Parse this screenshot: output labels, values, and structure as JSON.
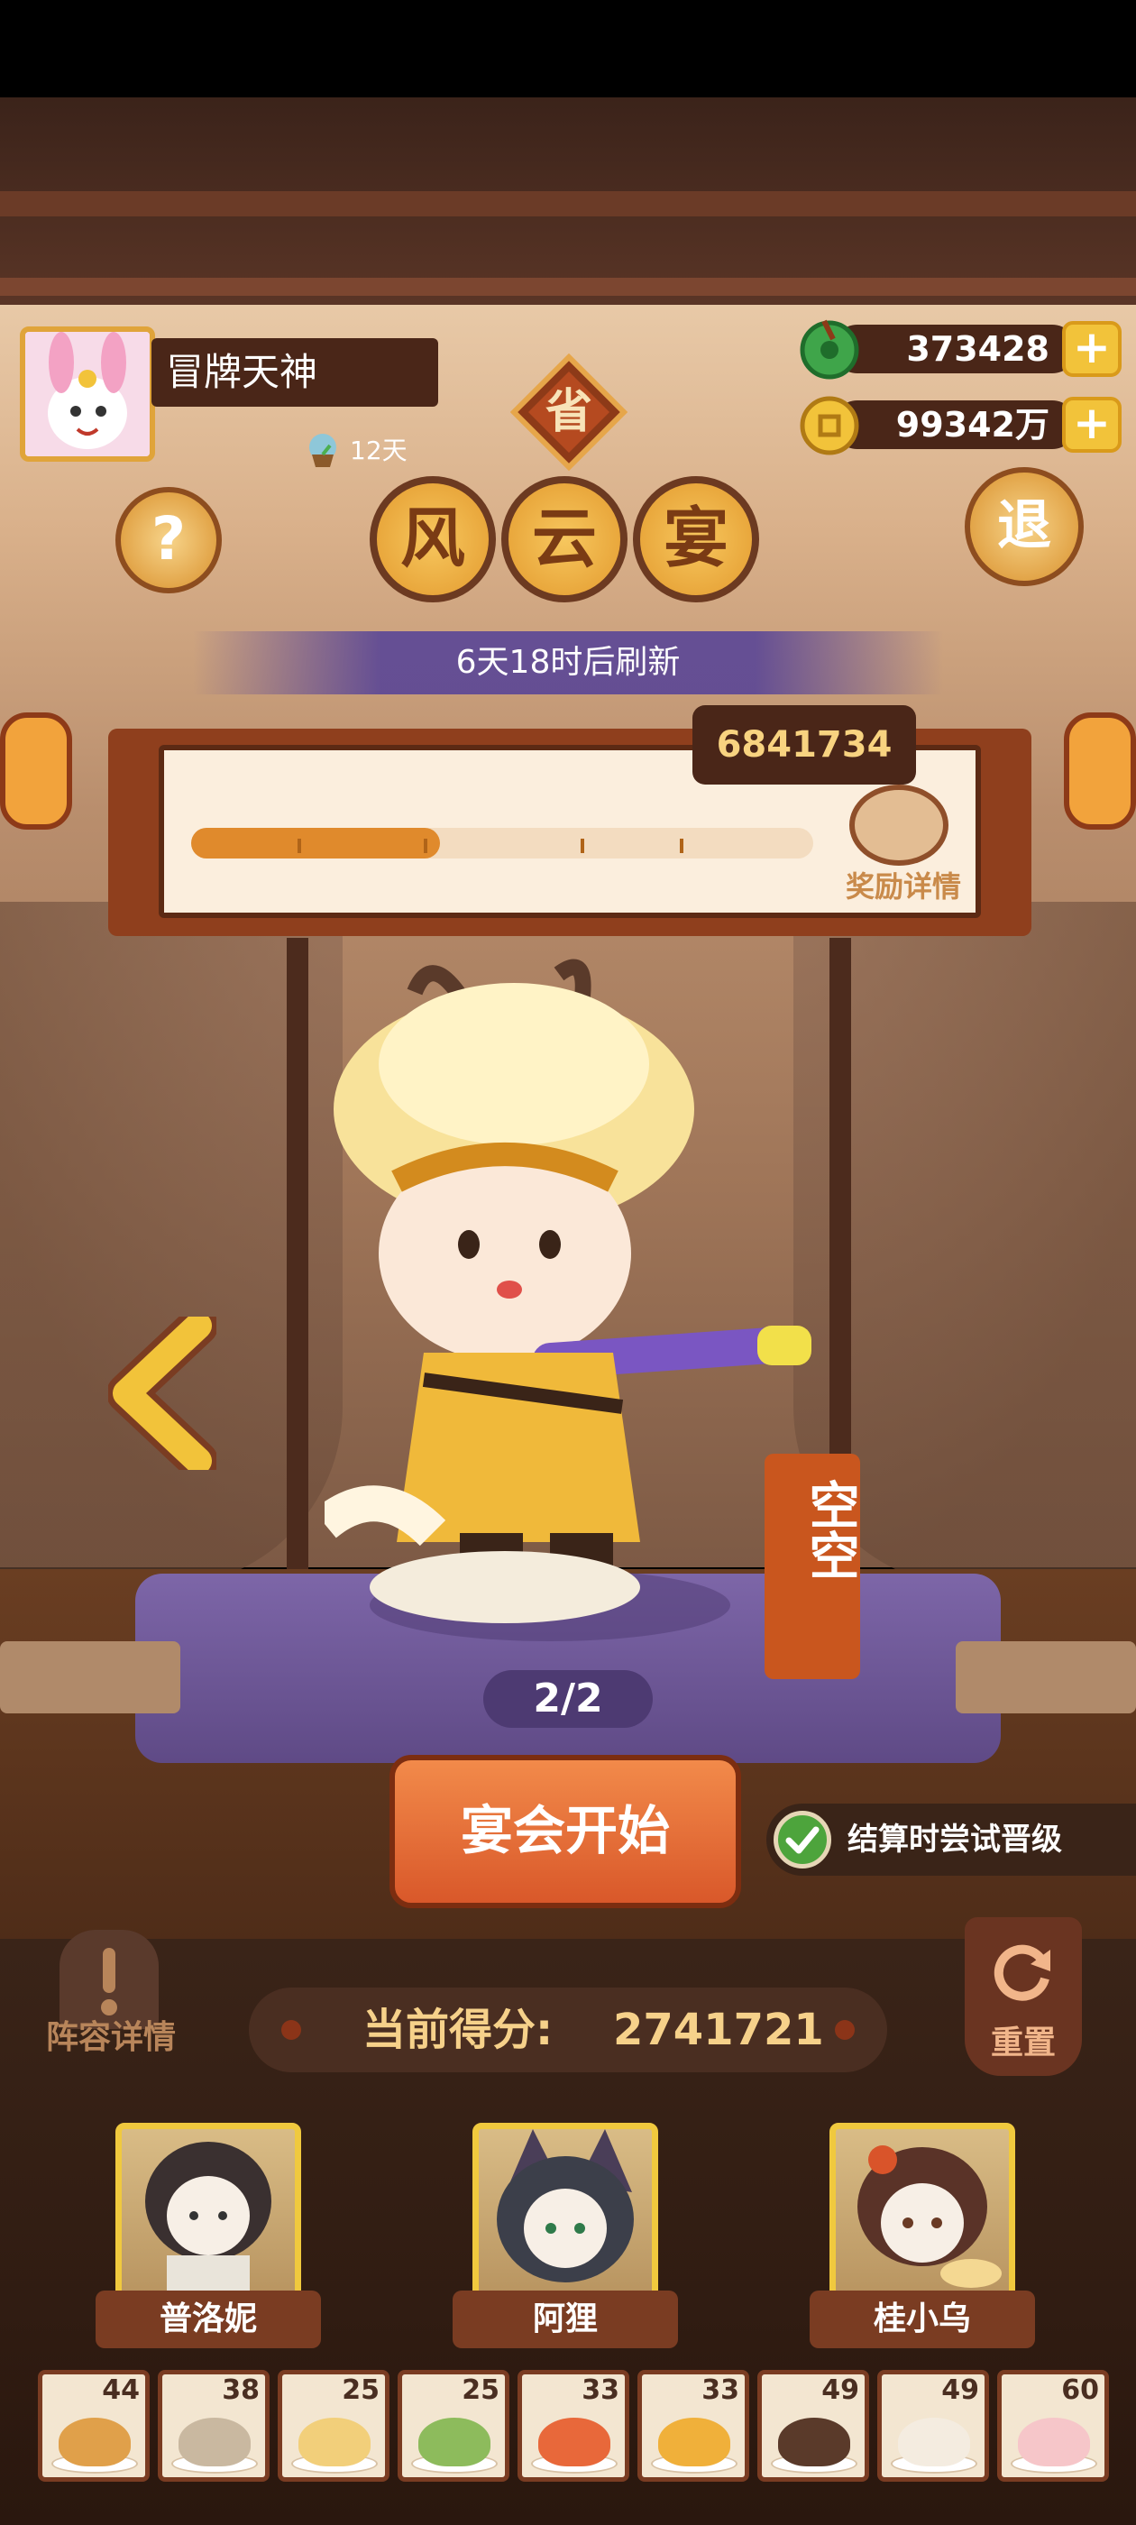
{
  "player": {
    "name": "冒牌天神",
    "days": "12天"
  },
  "rank_badge": "省",
  "currencies": [
    {
      "icon": "jade-coin-icon",
      "value": "373428"
    },
    {
      "icon": "gold-coin-icon",
      "value": "99342万"
    }
  ],
  "buttons": {
    "help": "?",
    "exit": "退",
    "start": "宴会开始",
    "lineup": "阵容详情",
    "reset": "重置",
    "try_upgrade": "结算时尝试晋级"
  },
  "event": {
    "title_chars": [
      "风",
      "云",
      "宴"
    ],
    "refresh": "6天18时后刷新"
  },
  "progress": {
    "target_score": "6841734",
    "fill_fraction": 0.4,
    "reward_label": "奖励详情"
  },
  "character": {
    "name": "空空",
    "page": "2/2"
  },
  "score": {
    "label": "当前得分:",
    "value": "2741721"
  },
  "chefs": [
    {
      "name": "普洛妮"
    },
    {
      "name": "阿狸"
    },
    {
      "name": "桂小乌"
    }
  ],
  "dishes": [
    {
      "count": "44",
      "color": "#e0a04a"
    },
    {
      "count": "38",
      "color": "#c9b8a0"
    },
    {
      "count": "25",
      "color": "#f2cf7a"
    },
    {
      "count": "25",
      "color": "#8dbb5c"
    },
    {
      "count": "33",
      "color": "#e8683a"
    },
    {
      "count": "33",
      "color": "#f0b03a"
    },
    {
      "count": "49",
      "color": "#5a3a2a"
    },
    {
      "count": "49",
      "color": "#f4ece0"
    },
    {
      "count": "60",
      "color": "#f6c6c9"
    }
  ],
  "colors": {
    "accent_orange": "#e08a2c",
    "wood_dark": "#4a2618",
    "gold": "#f0c93e",
    "purple_stage": "#5f4a86"
  }
}
